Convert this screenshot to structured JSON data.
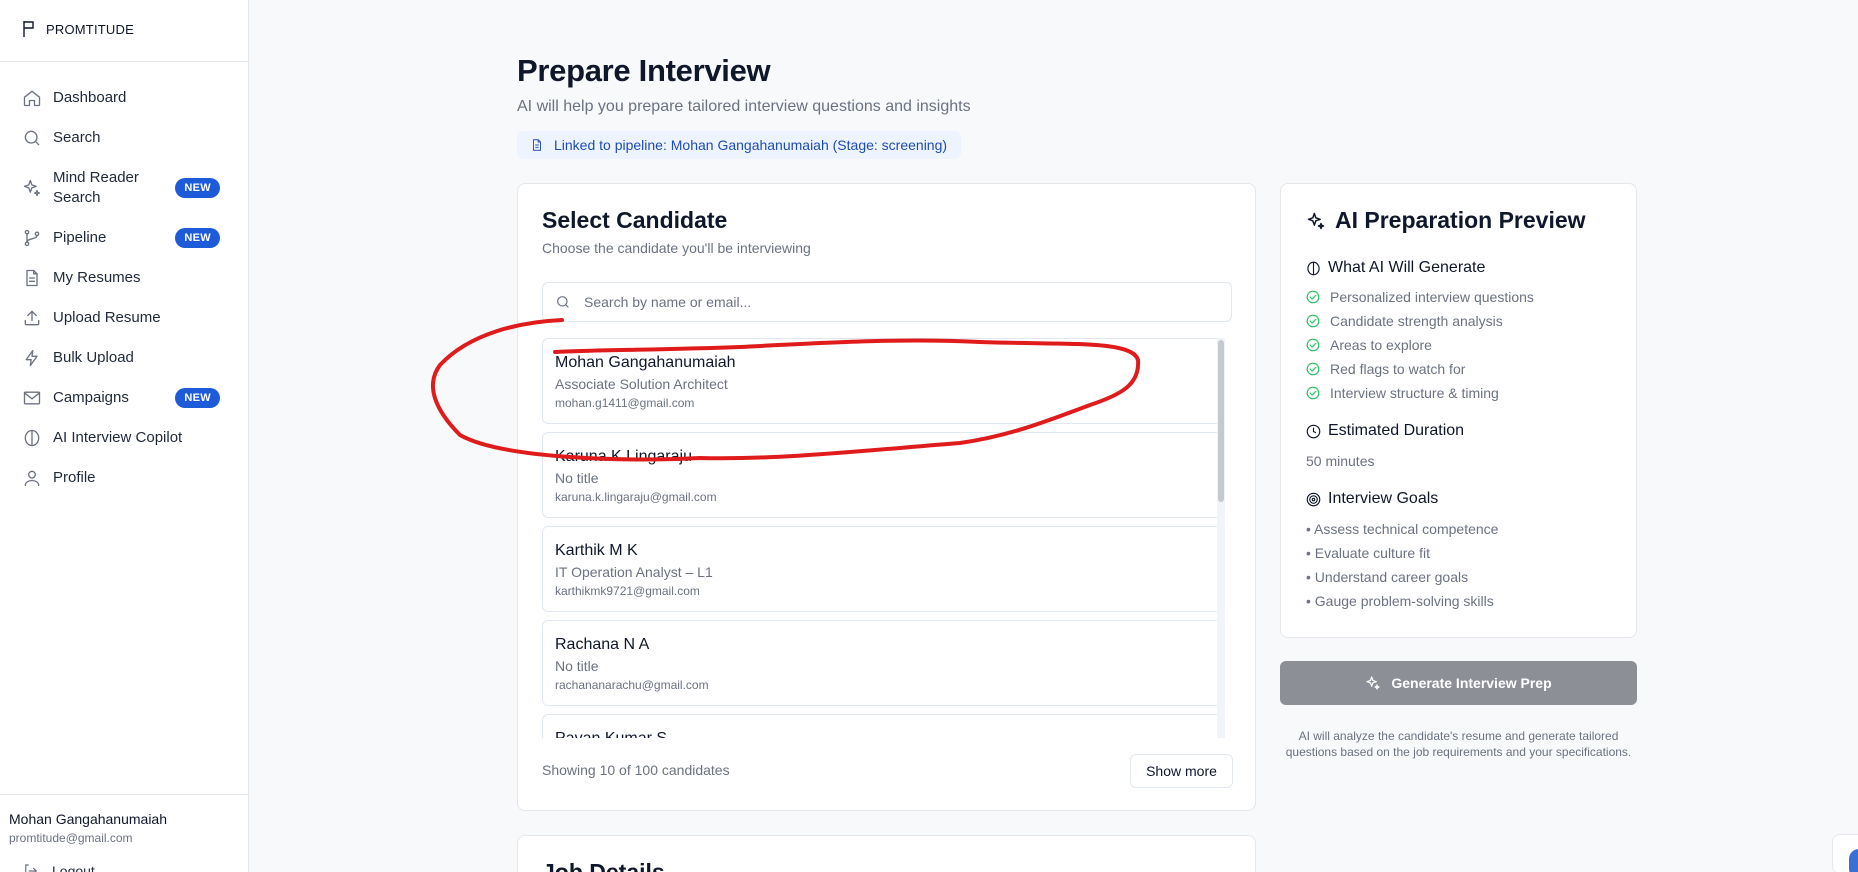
{
  "brand": {
    "name": "PROMTITUDE",
    "icon": "flag-icon"
  },
  "sidebar": {
    "items": [
      {
        "label": "Dashboard",
        "icon": "home-icon"
      },
      {
        "label": "Search",
        "icon": "search-icon"
      },
      {
        "label": "Mind Reader Search",
        "icon": "sparkles-icon",
        "badge": "NEW"
      },
      {
        "label": "Pipeline",
        "icon": "git-branch-icon",
        "badge": "NEW"
      },
      {
        "label": "My Resumes",
        "icon": "document-icon"
      },
      {
        "label": "Upload Resume",
        "icon": "upload-icon"
      },
      {
        "label": "Bulk Upload",
        "icon": "lightning-icon"
      },
      {
        "label": "Campaigns",
        "icon": "mail-icon",
        "badge": "NEW"
      },
      {
        "label": "AI Interview Copilot",
        "icon": "brain-icon"
      },
      {
        "label": "Profile",
        "icon": "user-icon"
      }
    ],
    "user": {
      "name": "Mohan Gangahanumaiah",
      "email": "promtitude@gmail.com"
    },
    "logout_label": "Logout"
  },
  "header": {
    "title": "Prepare Interview",
    "subtitle": "AI will help you prepare tailored interview questions and insights",
    "linked": "Linked to pipeline: Mohan Gangahanumaiah (Stage: screening)"
  },
  "select_candidate": {
    "title": "Select Candidate",
    "subtitle": "Choose the candidate you'll be interviewing",
    "search_placeholder": "Search by name or email...",
    "candidates": [
      {
        "name": "Mohan Gangahanumaiah",
        "title": "Associate Solution Architect",
        "email": "mohan.g1411@gmail.com"
      },
      {
        "name": "Karuna K Lingaraju",
        "title": "No title",
        "email": "karuna.k.lingaraju@gmail.com"
      },
      {
        "name": "Karthik M K",
        "title": "IT Operation Analyst – L1",
        "email": "karthikmk9721@gmail.com"
      },
      {
        "name": "Rachana N A",
        "title": "No title",
        "email": "rachananarachu@gmail.com"
      },
      {
        "name": "Pavan Kumar S",
        "title": "",
        "email": ""
      }
    ],
    "showing": "Showing 10 of 100 candidates",
    "show_more": "Show more"
  },
  "job_details": {
    "title": "Job Details"
  },
  "preview": {
    "title": "AI Preparation Preview",
    "generate_heading": "What AI Will Generate",
    "generate_items": [
      "Personalized interview questions",
      "Candidate strength analysis",
      "Areas to explore",
      "Red flags to watch for",
      "Interview structure & timing"
    ],
    "duration_heading": "Estimated Duration",
    "duration_value": "50 minutes",
    "goals_heading": "Interview Goals",
    "goals": [
      "• Assess technical competence",
      "• Evaluate culture fit",
      "• Understand career goals",
      "• Gauge problem-solving skills"
    ]
  },
  "generate_button": "Generate Interview Prep",
  "generate_note": "AI will analyze the candidate's resume and generate tailored questions based on the job requirements and your specifications.",
  "colors": {
    "accent": "#1d5bd8",
    "annotation": "#e01b1b",
    "check": "#22c55e",
    "button_disabled": "#8c8f96"
  }
}
